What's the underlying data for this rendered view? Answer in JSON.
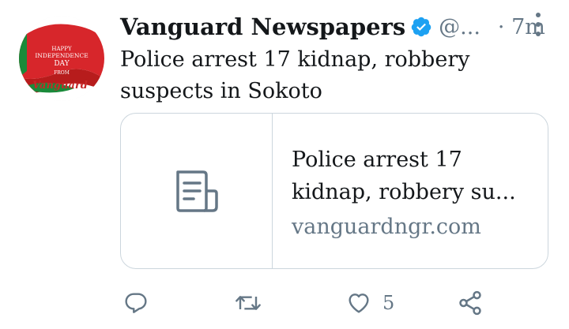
{
  "tweet": {
    "author": {
      "display_name": "Vanguard Newspapers",
      "handle": "@...",
      "verified": true,
      "avatar": {
        "line1": "HAPPY",
        "line2": "INDEPENDENCE",
        "line3": "DAY",
        "line4": "FROM",
        "brand": "Vanguard"
      }
    },
    "time": "· 7m",
    "text": "Police arrest 17 kidnap, robbery suspects in Sokoto",
    "card": {
      "icon": "document-icon",
      "title": "Police arrest 17 kidnap, robbery su...",
      "domain": "vanguardngr.com"
    },
    "actions": {
      "reply_icon": "reply-icon",
      "retweet_icon": "retweet-icon",
      "like_icon": "heart-icon",
      "like_count": "5",
      "share_icon": "share-icon"
    }
  },
  "colors": {
    "text": "#14171a",
    "secondary": "#657786",
    "verified": "#1da1f2",
    "border": "#ccd6dd",
    "avatar_red": "#d7262b",
    "avatar_green": "#1a8a3a"
  }
}
